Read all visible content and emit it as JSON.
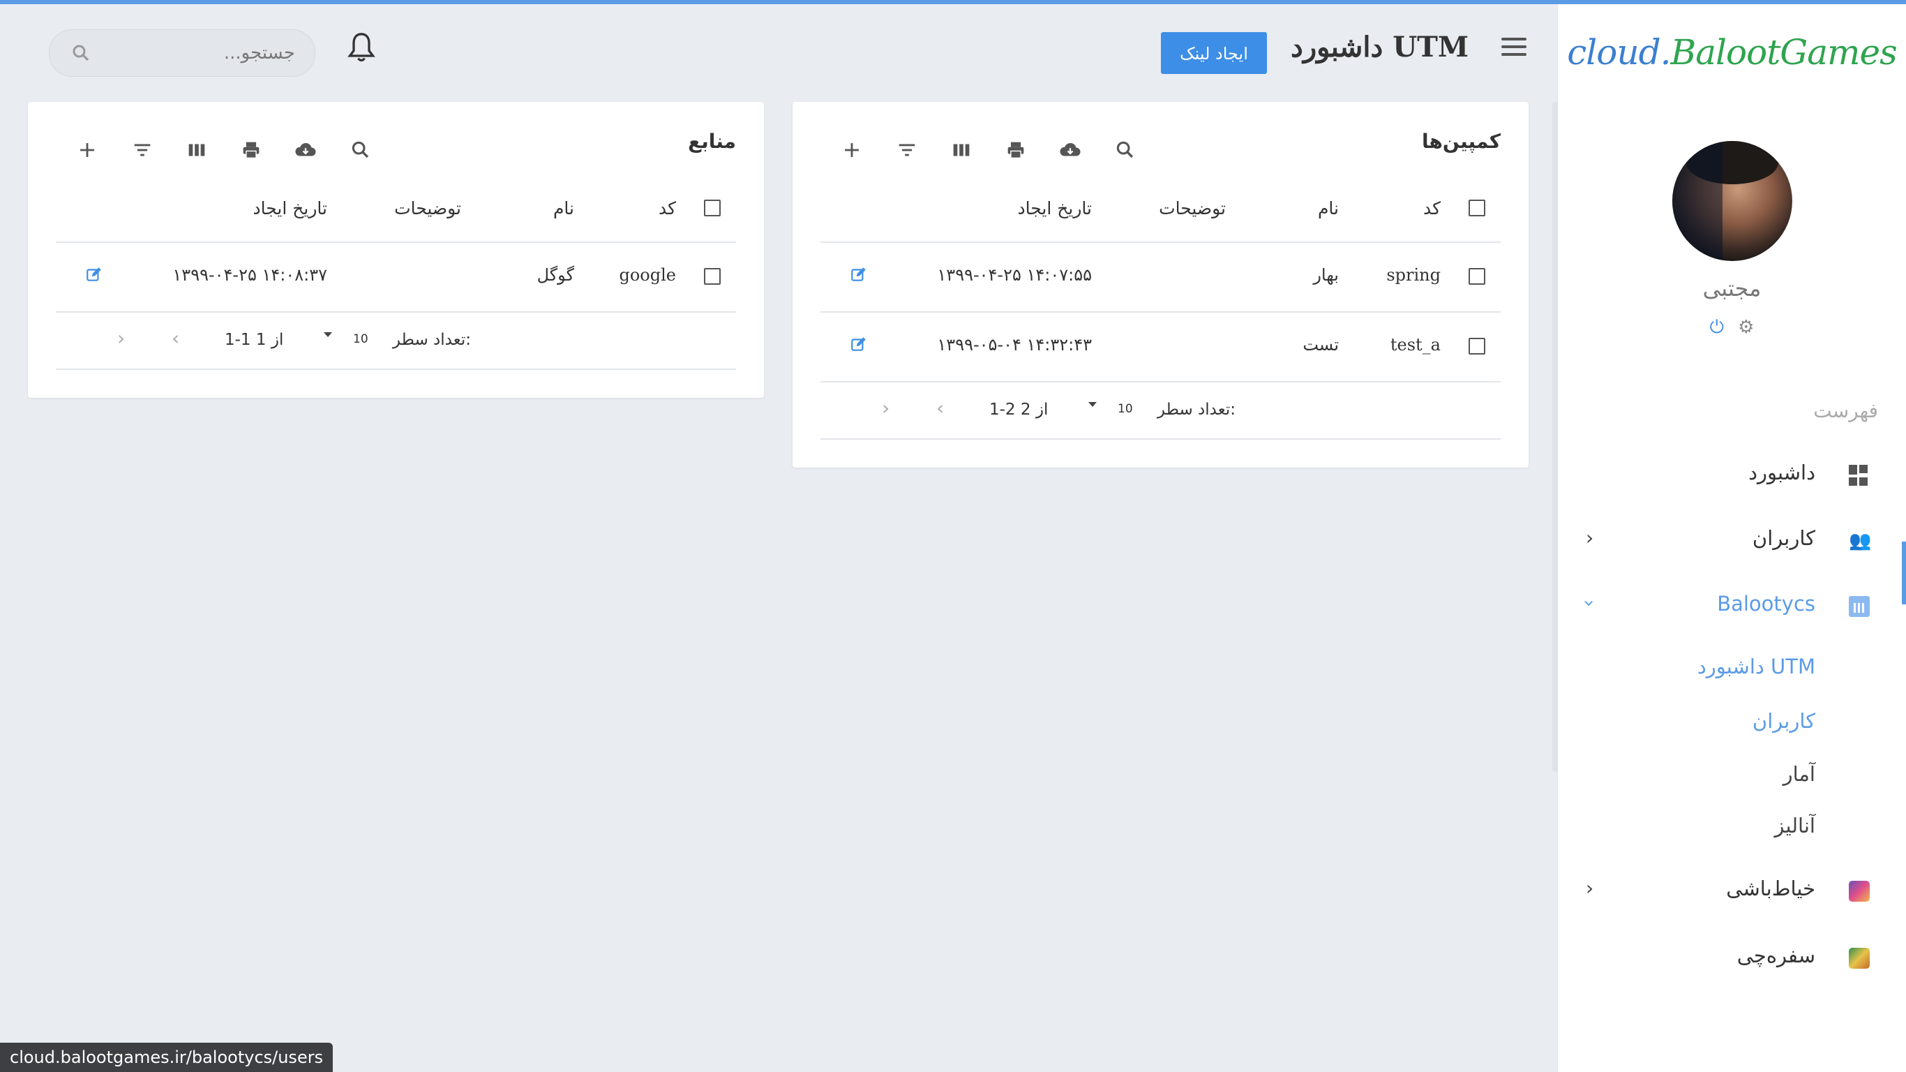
{
  "sidebar": {
    "logo_part1": "cloud.",
    "logo_part2": "BalootGames",
    "username": "مجتبی",
    "menu_title": "فهرست",
    "items": [
      {
        "label": "داشبورد",
        "icon": "dashboard-icon"
      },
      {
        "label": "کاربران",
        "icon": "users-icon"
      },
      {
        "label": "Balootycs",
        "icon": "chart-icon"
      },
      {
        "label": "خیاط‌باشی",
        "icon": "game-icon"
      },
      {
        "label": "سفره‌چی",
        "icon": "game-icon"
      }
    ],
    "subitems": [
      "داشبورد UTM",
      "کاربران",
      "آمار",
      "آنالیز"
    ]
  },
  "header": {
    "title": "داشبورد UTM",
    "create_button": "ایجاد لینک",
    "search_placeholder": "جستجو..."
  },
  "campaigns": {
    "title": "کمپین‌ها",
    "columns": [
      "کد",
      "نام",
      "توضیحات",
      "تاریخ ایجاد"
    ],
    "rows": [
      {
        "code": "spring",
        "name": "بهار",
        "description": "",
        "created": "۱۳۹۹-۰۴-۲۵ ۱۴:۰۷:۵۵"
      },
      {
        "code": "test_a",
        "name": "تست",
        "description": "",
        "created": "۱۳۹۹-۰۵-۰۴ ۱۴:۳۲:۴۳"
      }
    ],
    "rows_label": "تعداد سطر:",
    "rows_per_page": "10",
    "range": "1-2 از 2"
  },
  "sources": {
    "title": "منابع",
    "columns": [
      "کد",
      "نام",
      "توضیحات",
      "تاریخ ایجاد"
    ],
    "rows": [
      {
        "code": "google",
        "name": "گوگل",
        "description": "",
        "created": "۱۳۹۹-۰۴-۲۵ ۱۴:۰۸:۳۷"
      }
    ],
    "rows_label": "تعداد سطر:",
    "rows_per_page": "10",
    "range": "1-1 از 1"
  },
  "status_url": "cloud.balootgames.ir/balootycs/users",
  "colors": {
    "accent": "#3d8ee6",
    "background": "#e9ecf1",
    "logo_blue": "#3c7fd0",
    "logo_green": "#2ea44f"
  }
}
